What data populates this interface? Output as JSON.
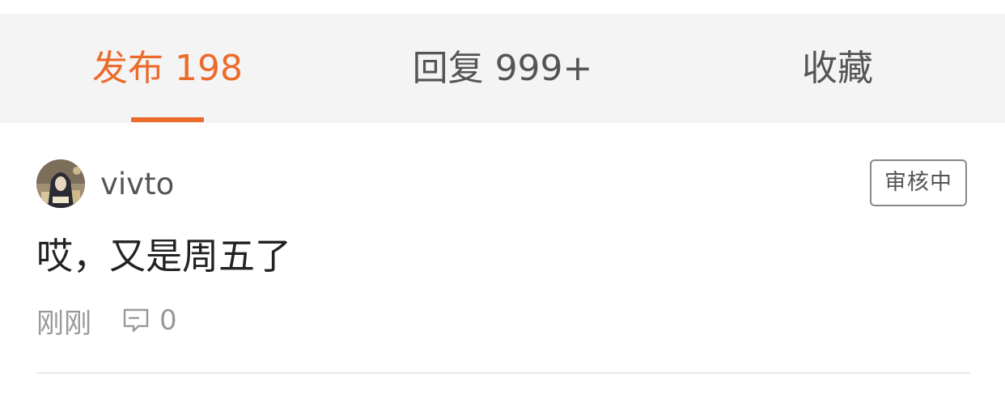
{
  "tabs": [
    {
      "label": "发布 198",
      "active": true
    },
    {
      "label": "回复 999+",
      "active": false
    },
    {
      "label": "收藏",
      "active": false
    }
  ],
  "colors": {
    "accent": "#eb6b2b",
    "tab_bar_bg": "#f4f4f5",
    "muted_text": "#999999"
  },
  "post": {
    "username": "vivto",
    "status_badge": "审核中",
    "content": "哎，又是周五了",
    "time": "刚刚",
    "comment_count": "0",
    "avatar_icon": "avatar-image",
    "comment_icon": "comment-bubble-icon"
  }
}
